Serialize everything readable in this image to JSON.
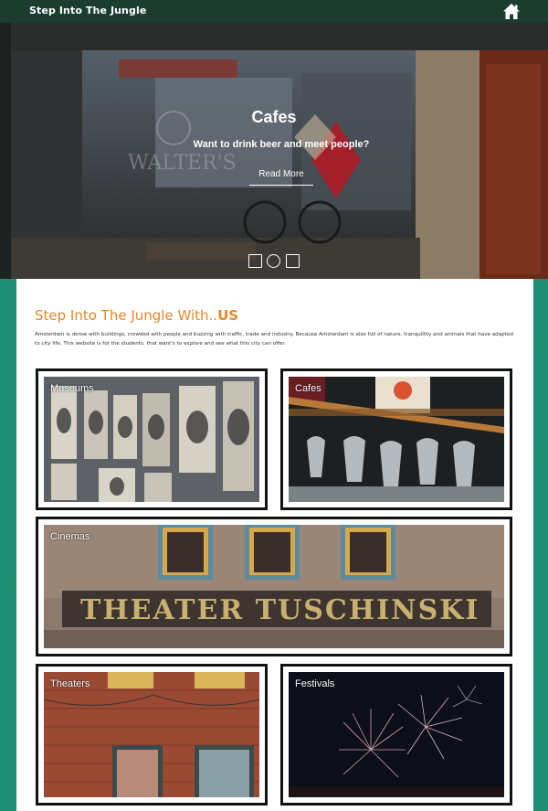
{
  "header": {
    "brand": "Step Into The Jungle",
    "home_icon": "home-icon"
  },
  "hero": {
    "title": "Cafes",
    "subtitle": "Want to drink beer and meet people?",
    "button": "Read More",
    "indicators": [
      "square",
      "circle",
      "square"
    ]
  },
  "intro": {
    "title_prefix": "Step Into The Jungle With..",
    "title_emph": "US",
    "text": "Amsterdam is dense with buildings, crowded with people and buzzing with traffic, trade and industry. Because Amsterdam is also full of nature, tranquillity and animals that have adapted to city life. This website is fot the students. that want's to explore and see what this city can offer."
  },
  "tiles": [
    {
      "label": "Museums"
    },
    {
      "label": "Cafes"
    },
    {
      "label": "Cinemas"
    },
    {
      "label": "Theaters"
    },
    {
      "label": "Festivals"
    }
  ],
  "colors": {
    "topbar": "#1b3d30",
    "accent": "#e8872a",
    "jungle": "#1f8f73"
  }
}
